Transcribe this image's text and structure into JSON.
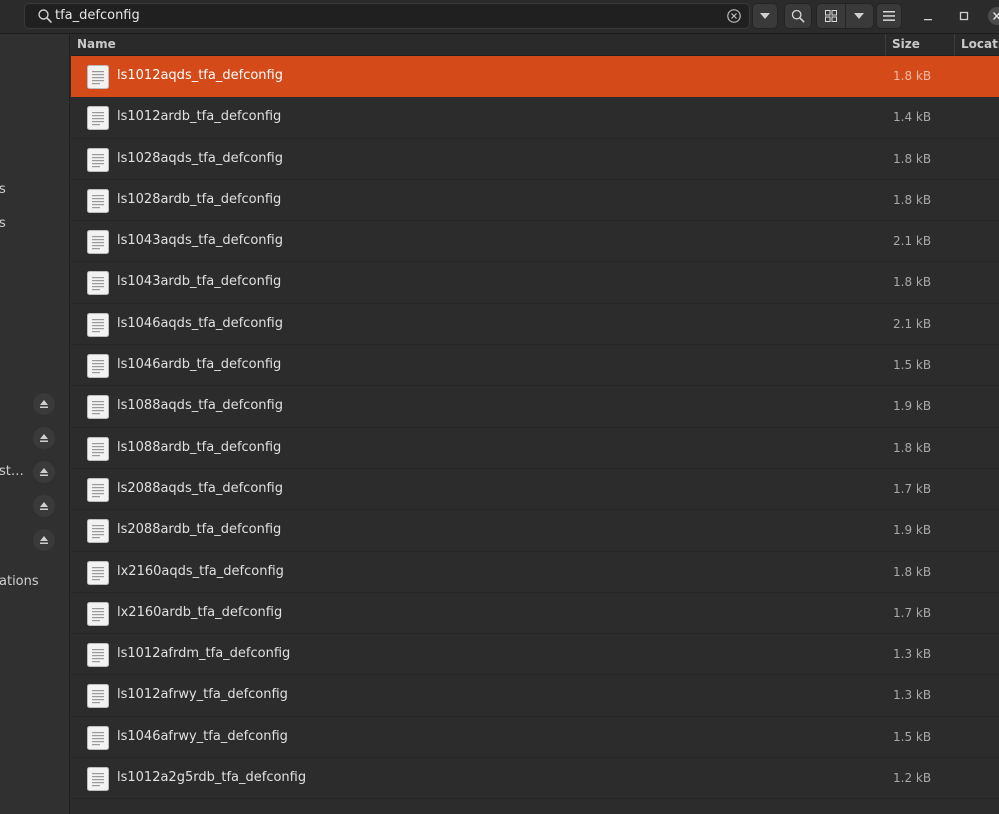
{
  "search": {
    "query": "tfa_defconfig"
  },
  "sidebar": {
    "labels": [
      "s",
      "s",
      "st…",
      "ations"
    ]
  },
  "columns": {
    "name": "Name",
    "size": "Size",
    "location": "Locati"
  },
  "files": [
    {
      "name": "ls1012aqds_tfa_defconfig",
      "size": "1.8 kB",
      "selected": true
    },
    {
      "name": "ls1012ardb_tfa_defconfig",
      "size": "1.4 kB"
    },
    {
      "name": "ls1028aqds_tfa_defconfig",
      "size": "1.8 kB"
    },
    {
      "name": "ls1028ardb_tfa_defconfig",
      "size": "1.8 kB"
    },
    {
      "name": "ls1043aqds_tfa_defconfig",
      "size": "2.1 kB"
    },
    {
      "name": "ls1043ardb_tfa_defconfig",
      "size": "1.8 kB"
    },
    {
      "name": "ls1046aqds_tfa_defconfig",
      "size": "2.1 kB"
    },
    {
      "name": "ls1046ardb_tfa_defconfig",
      "size": "1.5 kB"
    },
    {
      "name": "ls1088aqds_tfa_defconfig",
      "size": "1.9 kB"
    },
    {
      "name": "ls1088ardb_tfa_defconfig",
      "size": "1.8 kB"
    },
    {
      "name": "ls2088aqds_tfa_defconfig",
      "size": "1.7 kB"
    },
    {
      "name": "ls2088ardb_tfa_defconfig",
      "size": "1.9 kB"
    },
    {
      "name": "lx2160aqds_tfa_defconfig",
      "size": "1.8 kB"
    },
    {
      "name": "lx2160ardb_tfa_defconfig",
      "size": "1.7 kB"
    },
    {
      "name": "ls1012afrdm_tfa_defconfig",
      "size": "1.3 kB"
    },
    {
      "name": "ls1012afrwy_tfa_defconfig",
      "size": "1.3 kB"
    },
    {
      "name": "ls1046afrwy_tfa_defconfig",
      "size": "1.5 kB"
    },
    {
      "name": "ls1012a2g5rdb_tfa_defconfig",
      "size": "1.2 kB"
    }
  ],
  "colors": {
    "selection": "#d44a18",
    "background": "#2c2c2c",
    "sidebar": "#303030"
  }
}
